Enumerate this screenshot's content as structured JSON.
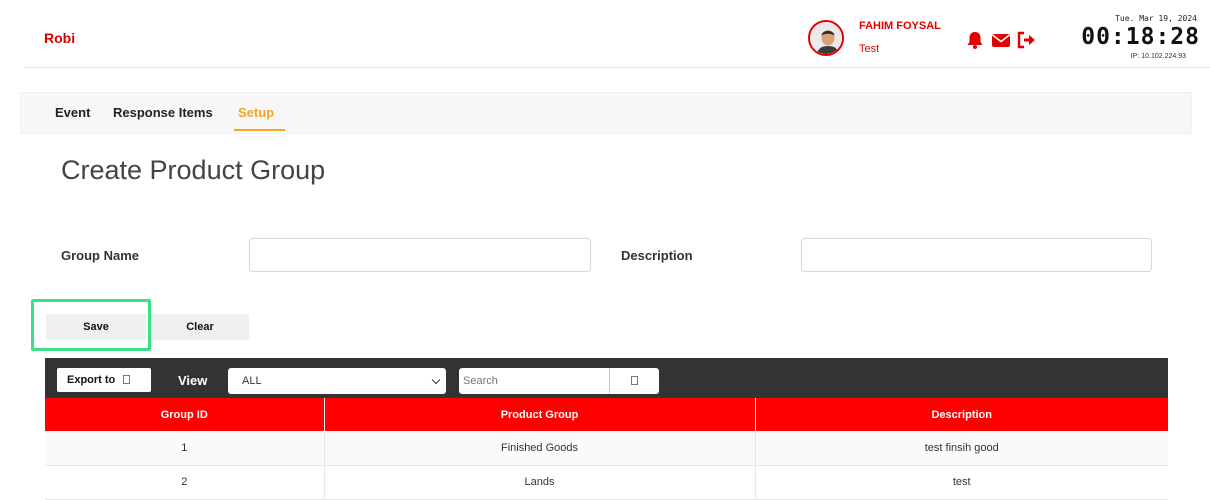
{
  "header": {
    "brand": "Robi",
    "user_name": "FAHIM FOYSAL",
    "user_role": "Test",
    "date": "Tue. Mar 19, 2024",
    "time": "00:18:28",
    "ip": "IP: 10.102.224.93",
    "accent_color": "#e40000"
  },
  "tabs": [
    {
      "label": "Event"
    },
    {
      "label": "Response Items"
    },
    {
      "label": "Setup",
      "active": true
    }
  ],
  "page_title": "Create Product Group",
  "form": {
    "group_name_label": "Group Name",
    "group_name_value": "",
    "description_label": "Description",
    "description_value": ""
  },
  "buttons": {
    "save": "Save",
    "clear": "Clear"
  },
  "toolbar": {
    "export_label": "Export to",
    "view_label": "View",
    "view_selected": "ALL",
    "search_placeholder": "Search"
  },
  "table": {
    "headers": [
      "Group ID",
      "Product Group",
      "Description"
    ],
    "rows": [
      [
        "1",
        "Finished Goods",
        "test finsih good"
      ],
      [
        "2",
        "Lands",
        "test"
      ]
    ]
  }
}
